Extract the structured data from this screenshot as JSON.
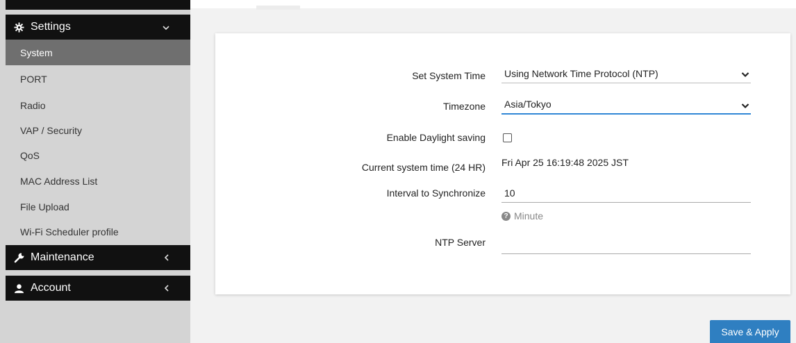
{
  "sidebar": {
    "settings": {
      "label": "Settings"
    },
    "items": [
      {
        "label": "System"
      },
      {
        "label": "PORT"
      },
      {
        "label": "Radio"
      },
      {
        "label": "VAP / Security"
      },
      {
        "label": "QoS"
      },
      {
        "label": "MAC Address List"
      },
      {
        "label": "File Upload"
      },
      {
        "label": "Wi-Fi Scheduler profile"
      }
    ],
    "maintenance": {
      "label": "Maintenance"
    },
    "account": {
      "label": "Account"
    }
  },
  "form": {
    "set_system_time": {
      "label": "Set System Time",
      "value": "Using Network Time Protocol (NTP)"
    },
    "timezone": {
      "label": "Timezone",
      "value": "Asia/Tokyo"
    },
    "daylight": {
      "label": "Enable Daylight saving",
      "checked": false
    },
    "current_time": {
      "label": "Current system time (24 HR)",
      "value": "Fri Apr 25 16:19:48 2025 JST"
    },
    "interval": {
      "label": "Interval to Synchronize",
      "value": "10",
      "help": "Minute"
    },
    "ntp_server": {
      "label": "NTP Server",
      "value": ""
    }
  },
  "actions": {
    "save_apply": "Save & Apply"
  },
  "colors": {
    "accent": "#2f7fc1",
    "sidebar_dark": "#111111",
    "sidebar_active": "#6f6f6f",
    "sidebar_bg": "#d4d4d4"
  },
  "icons": {
    "settings": "gear-icon",
    "maintenance": "wrench-icon",
    "account": "user-icon",
    "help": "question-circle-icon"
  }
}
